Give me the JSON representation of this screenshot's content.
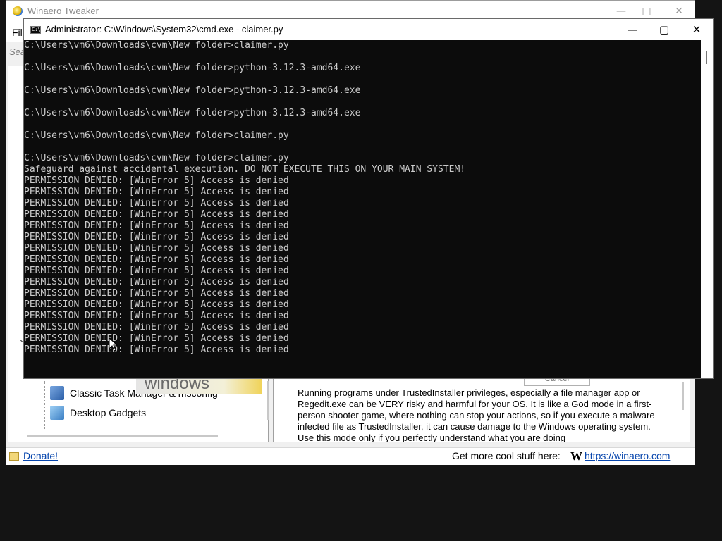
{
  "winaero": {
    "title": "Winaero Tweaker",
    "menu_file": "File",
    "search_placeholder": "Search",
    "tree_items": [
      {
        "label": "Classic Task Manager & msconfig",
        "icon": "task-manager-icon"
      },
      {
        "label": "Desktop Gadgets",
        "icon": "gadgets-icon"
      }
    ],
    "banner_text": "windows",
    "cancel_label": "Cancel",
    "description": "Running programs under TrustedInstaller privileges, especially a file manager app or Regedit.exe can be VERY risky and harmful for your OS. It is like a God mode in a first-person shooter game, where nothing can stop your actions, so if you execute a malware infected file as TrustedInstaller, it can cause damage to the Windows operating system. Use this mode only if you perfectly understand what you are doing",
    "donate_label": "Donate!",
    "status_text": "Get more cool stuff here:",
    "logo_letter": "W",
    "site_link": "https://winaero.com"
  },
  "cmd": {
    "title": "Administrator: C:\\Windows\\System32\\cmd.exe - claimer.py",
    "lines": [
      "C:\\Users\\vm6\\Downloads\\cvm\\New folder>claimer.py",
      "",
      "C:\\Users\\vm6\\Downloads\\cvm\\New folder>python-3.12.3-amd64.exe",
      "",
      "C:\\Users\\vm6\\Downloads\\cvm\\New folder>python-3.12.3-amd64.exe",
      "",
      "C:\\Users\\vm6\\Downloads\\cvm\\New folder>python-3.12.3-amd64.exe",
      "",
      "C:\\Users\\vm6\\Downloads\\cvm\\New folder>claimer.py",
      "",
      "C:\\Users\\vm6\\Downloads\\cvm\\New folder>claimer.py",
      "Safeguard against accidental execution. DO NOT EXECUTE THIS ON YOUR MAIN SYSTEM!",
      "PERMISSION DENIED: [WinError 5] Access is denied",
      "PERMISSION DENIED: [WinError 5] Access is denied",
      "PERMISSION DENIED: [WinError 5] Access is denied",
      "PERMISSION DENIED: [WinError 5] Access is denied",
      "PERMISSION DENIED: [WinError 5] Access is denied",
      "PERMISSION DENIED: [WinError 5] Access is denied",
      "PERMISSION DENIED: [WinError 5] Access is denied",
      "PERMISSION DENIED: [WinError 5] Access is denied",
      "PERMISSION DENIED: [WinError 5] Access is denied",
      "PERMISSION DENIED: [WinError 5] Access is denied",
      "PERMISSION DENIED: [WinError 5] Access is denied",
      "PERMISSION DENIED: [WinError 5] Access is denied",
      "PERMISSION DENIED: [WinError 5] Access is denied",
      "PERMISSION DENIED: [WinError 5] Access is denied",
      "PERMISSION DENIED: [WinError 5] Access is denied",
      "PERMISSION DENIED: [WinError 5] Access is denied"
    ]
  }
}
